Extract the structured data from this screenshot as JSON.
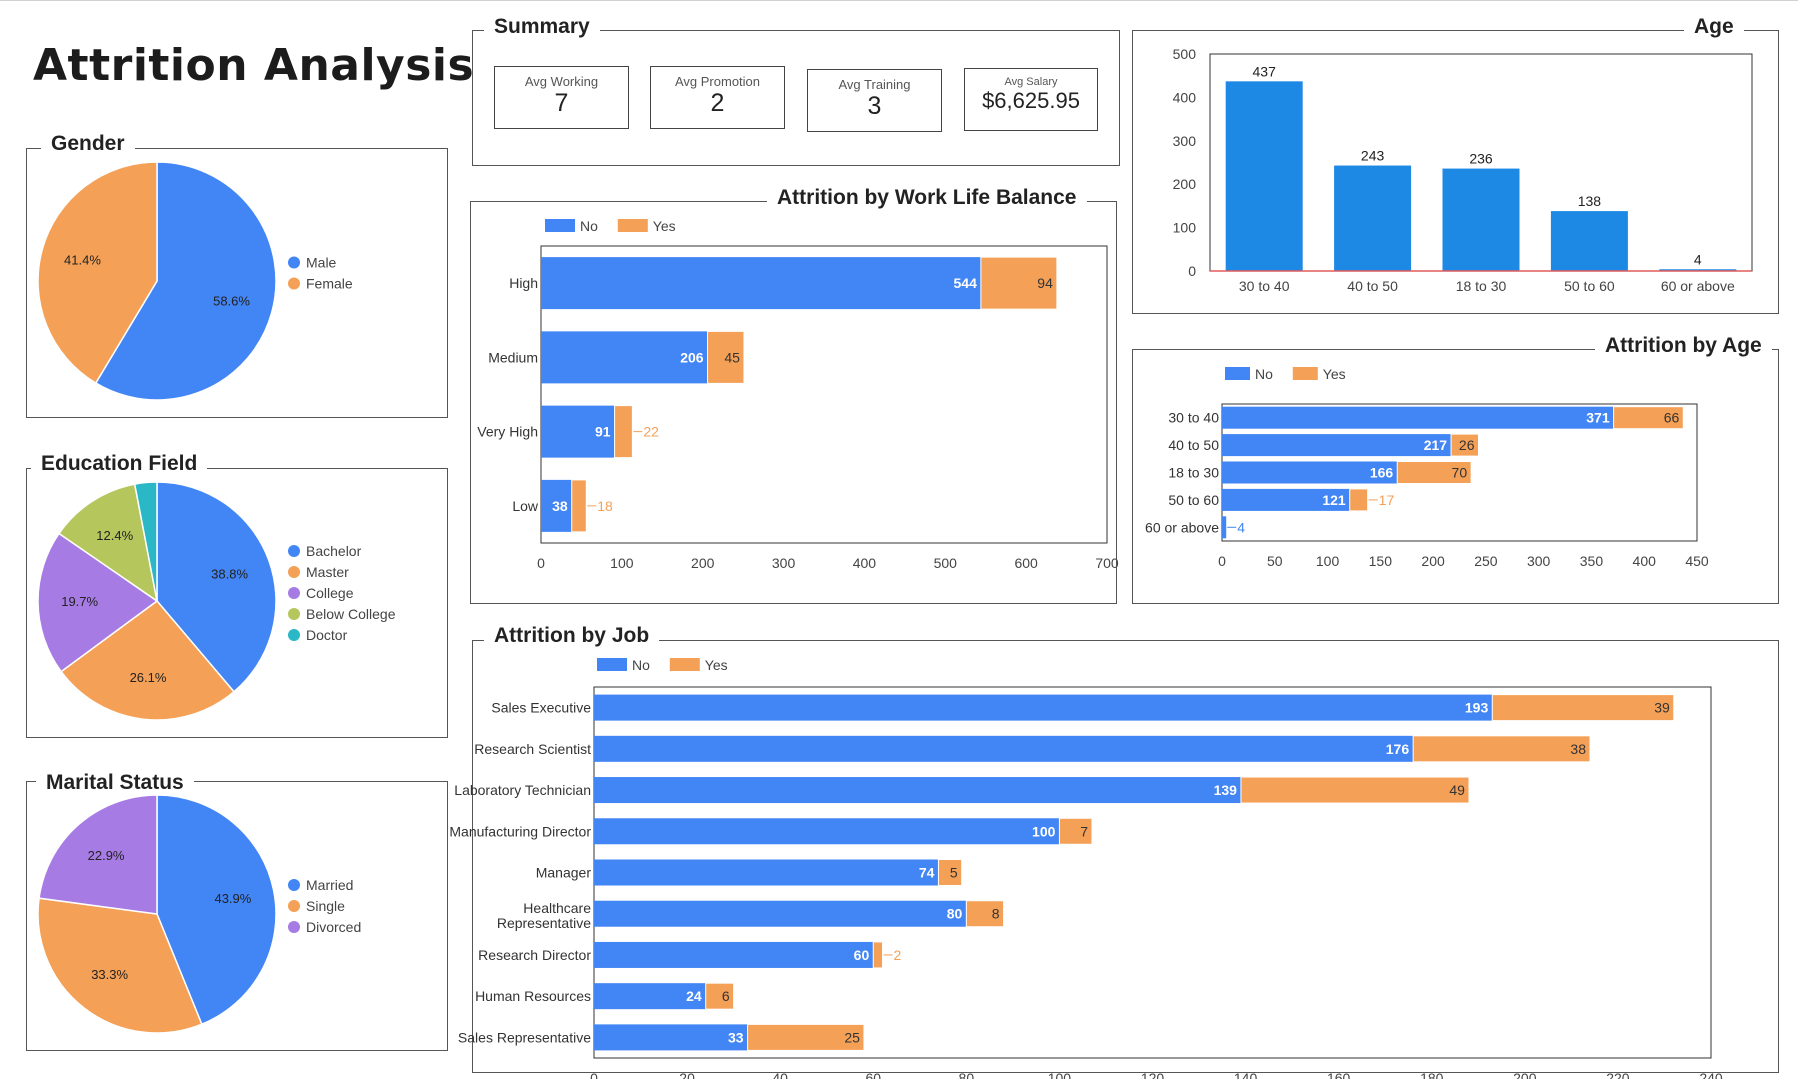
{
  "page": {
    "title": "Attrition Analysis"
  },
  "summary": {
    "title": "Summary",
    "kpis": [
      {
        "label": "Avg Working",
        "value": "7"
      },
      {
        "label": "Avg Promotion",
        "value": "2"
      },
      {
        "label": "Avg Training",
        "value": "3"
      },
      {
        "label": "Avg Salary",
        "value": "$6,625.95"
      }
    ]
  },
  "colors": {
    "blue": "#4285f4",
    "orange": "#f4a056",
    "purple": "#a77be4",
    "green": "#b5c65d",
    "teal": "#2ab7c6",
    "agebar": "#1e88e5",
    "red_axis": "#e05c5c"
  },
  "chart_data": [
    {
      "id": "gender",
      "type": "pie",
      "title": "Gender",
      "labels": [
        "Male",
        "Female"
      ],
      "values": [
        58.6,
        41.4
      ],
      "value_labels": [
        "58.6%",
        "41.4%"
      ],
      "colors": [
        "#4285f4",
        "#f4a056"
      ],
      "legend": "right"
    },
    {
      "id": "education",
      "type": "pie",
      "title": "Education Field",
      "labels": [
        "Bachelor",
        "Master",
        "College",
        "Below College",
        "Doctor"
      ],
      "values": [
        38.8,
        26.1,
        19.7,
        12.4,
        3.0
      ],
      "value_labels": [
        "38.8%",
        "26.1%",
        "19.7%",
        "12.4%",
        ""
      ],
      "colors": [
        "#4285f4",
        "#f4a056",
        "#a77be4",
        "#b5c65d",
        "#2ab7c6"
      ],
      "legend": "right"
    },
    {
      "id": "marital",
      "type": "pie",
      "title": "Marital Status",
      "labels": [
        "Married",
        "Single",
        "Divorced"
      ],
      "values": [
        43.9,
        33.3,
        22.9
      ],
      "value_labels": [
        "43.9%",
        "33.3%",
        "22.9%"
      ],
      "colors": [
        "#4285f4",
        "#f4a056",
        "#a77be4"
      ],
      "legend": "right"
    },
    {
      "id": "worklife",
      "type": "bar",
      "orientation": "horizontal",
      "stacked": true,
      "title": "Attrition by Work Life Balance",
      "categories": [
        "High",
        "Medium",
        "Very High",
        "Low"
      ],
      "series": [
        {
          "name": "No",
          "values": [
            544,
            206,
            91,
            38
          ],
          "color": "#4285f4"
        },
        {
          "name": "Yes",
          "values": [
            94,
            45,
            22,
            18
          ],
          "color": "#f4a056"
        }
      ],
      "xlim": [
        0,
        700
      ],
      "ticks": [
        "0",
        "100",
        "200",
        "300",
        "400",
        "500",
        "600",
        "700"
      ],
      "legend": "top-left"
    },
    {
      "id": "age",
      "type": "bar",
      "orientation": "vertical",
      "title": "Age",
      "categories": [
        "30 to 40",
        "40 to 50",
        "18 to 30",
        "50 to 60",
        "60 or above"
      ],
      "values": [
        437,
        243,
        236,
        138,
        4
      ],
      "ylim": [
        0,
        500
      ],
      "ticks": [
        "0",
        "100",
        "200",
        "300",
        "400",
        "500"
      ],
      "color": "#1e88e5"
    },
    {
      "id": "attrage",
      "type": "bar",
      "orientation": "horizontal",
      "stacked": true,
      "title": "Attrition by Age",
      "categories": [
        "30 to 40",
        "40 to 50",
        "18 to 30",
        "50 to 60",
        "60 or above"
      ],
      "series": [
        {
          "name": "No",
          "values": [
            371,
            217,
            166,
            121,
            4
          ],
          "color": "#4285f4"
        },
        {
          "name": "Yes",
          "values": [
            66,
            26,
            70,
            17,
            0
          ],
          "color": "#f4a056"
        }
      ],
      "xlim": [
        0,
        450
      ],
      "ticks": [
        "0",
        "50",
        "100",
        "150",
        "200",
        "250",
        "300",
        "350",
        "400",
        "450"
      ],
      "legend": "top-left"
    },
    {
      "id": "job",
      "type": "bar",
      "orientation": "horizontal",
      "stacked": true,
      "title": "Attrition by Job",
      "categories": [
        "Sales Executive",
        "Research Scientist",
        "Laboratory Technician",
        "Manufacturing Director",
        "Manager",
        "Healthcare Representative",
        "Research Director",
        "Human Resources",
        "Sales Representative"
      ],
      "series": [
        {
          "name": "No",
          "values": [
            193,
            176,
            139,
            100,
            74,
            80,
            60,
            24,
            33
          ],
          "color": "#4285f4"
        },
        {
          "name": "Yes",
          "values": [
            39,
            38,
            49,
            7,
            5,
            8,
            2,
            6,
            25
          ],
          "color": "#f4a056"
        }
      ],
      "xlim": [
        0,
        240
      ],
      "ticks": [
        "0",
        "20",
        "40",
        "60",
        "80",
        "100",
        "120",
        "140",
        "160",
        "180",
        "200",
        "220",
        "240"
      ],
      "legend": "top-left"
    }
  ]
}
